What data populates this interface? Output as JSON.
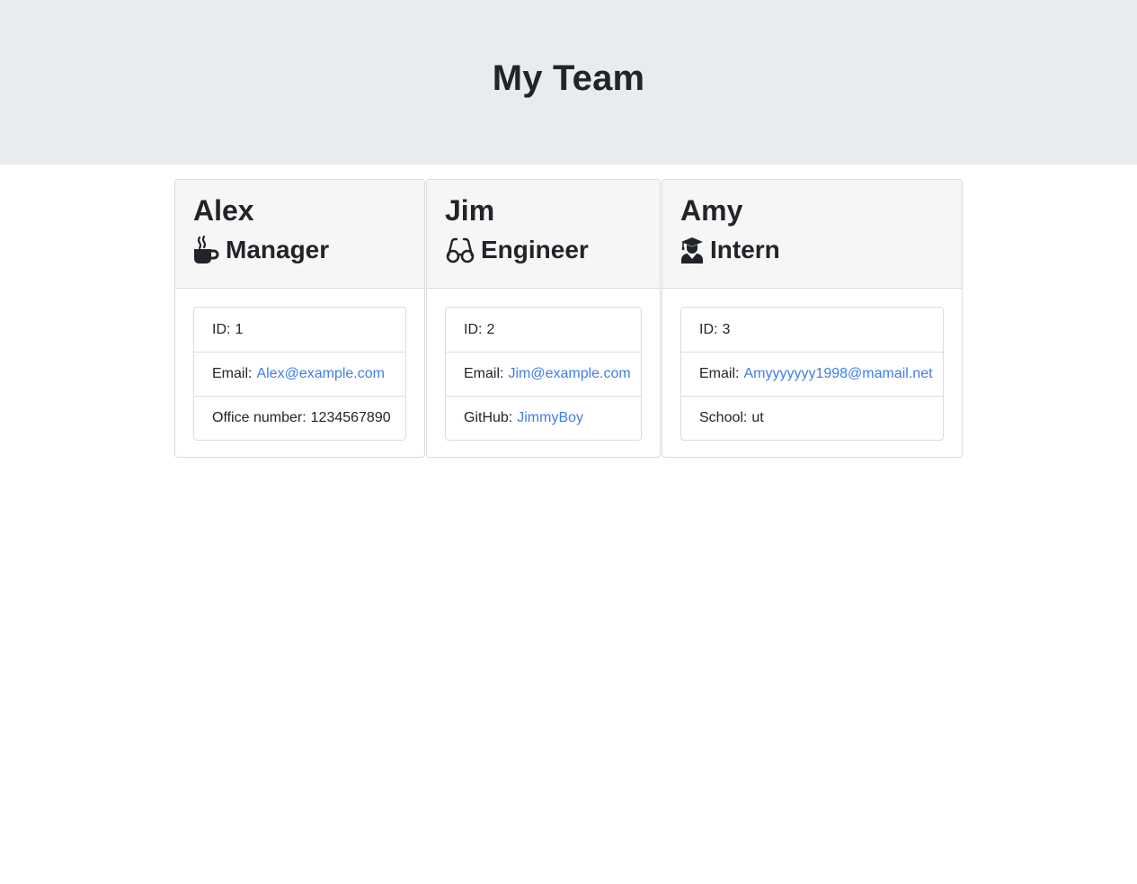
{
  "header": {
    "title": "My Team"
  },
  "colors": {
    "link": "#3f7ee8",
    "header_bg": "#e9ecef",
    "card_header_bg": "#f6f6f6",
    "text": "#212529"
  },
  "employees": [
    {
      "name": "Alex",
      "role": "Manager",
      "icon": "coffee-mug-icon",
      "id_label": "ID:",
      "id": "1",
      "email_label": "Email:",
      "email": "Alex@example.com",
      "extra_label": "Office number:",
      "extra": "1234567890"
    },
    {
      "name": "Jim",
      "role": "Engineer",
      "icon": "glasses-icon",
      "id_label": "ID:",
      "id": "2",
      "email_label": "Email:",
      "email": "Jim@example.com",
      "extra_label": "GitHub:",
      "extra": "JimmyBoy"
    },
    {
      "name": "Amy",
      "role": "Intern",
      "icon": "graduate-icon",
      "id_label": "ID:",
      "id": "3",
      "email_label": "Email:",
      "email": "Amyyyyyyy1998@mamail.net",
      "extra_label": "School:",
      "extra": "ut"
    }
  ]
}
